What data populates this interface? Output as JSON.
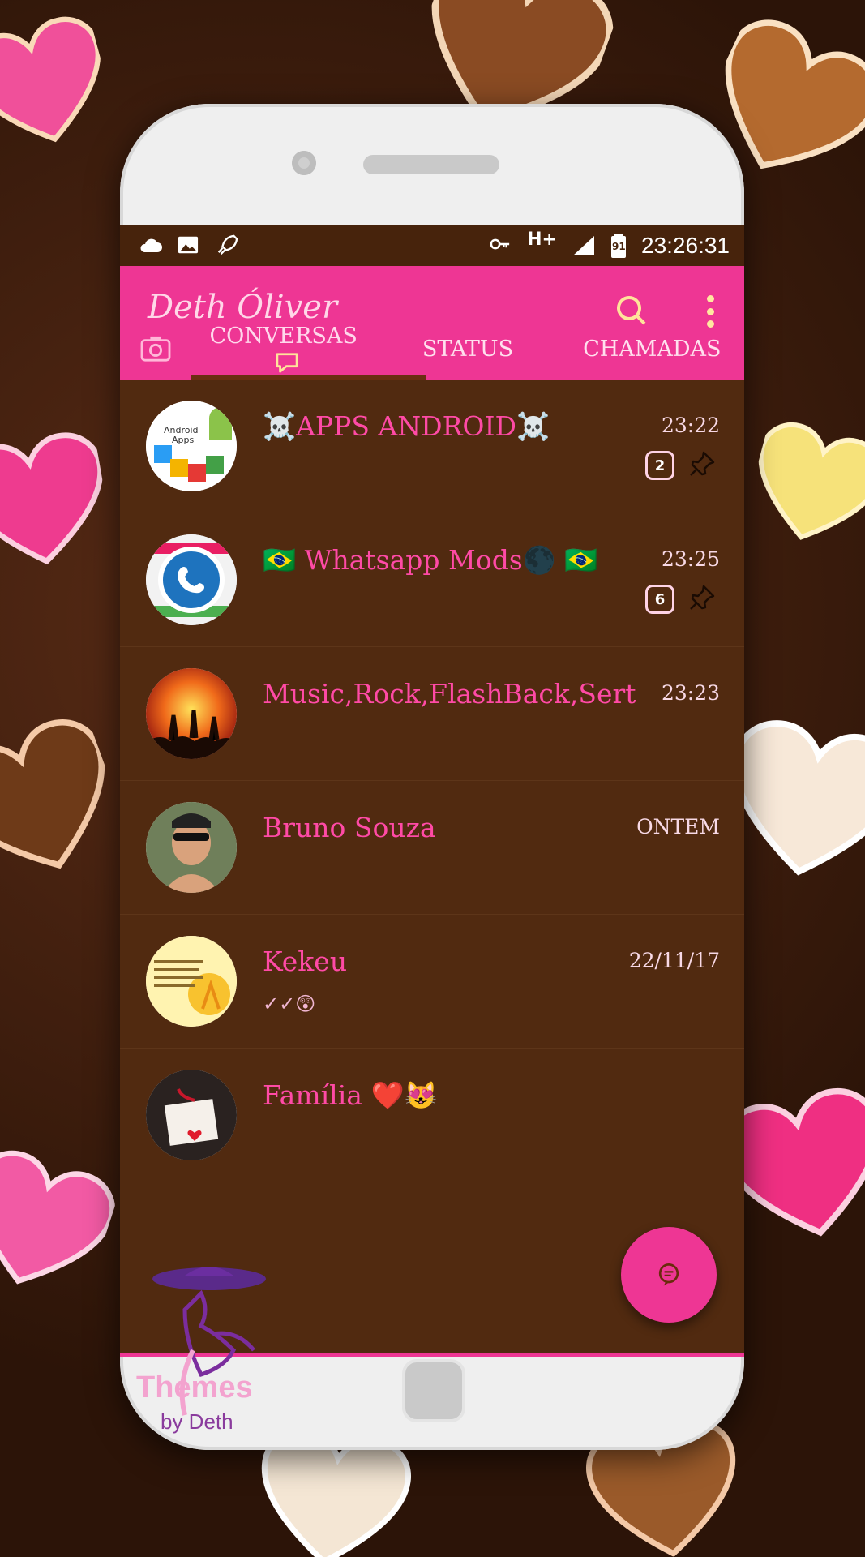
{
  "status_bar": {
    "network": "H+",
    "battery": "91",
    "time": "23:26:31"
  },
  "app": {
    "title": "Deth Óliver"
  },
  "tabs": [
    {
      "label": "CONVERSAS"
    },
    {
      "label": "STATUS"
    },
    {
      "label": "CHAMADAS"
    }
  ],
  "chats": [
    {
      "name": "☠️APPS ANDROID☠️",
      "time": "23:22",
      "subtitle": "",
      "unread": "2",
      "pinned": true
    },
    {
      "name": "🇧🇷 Whatsapp Mods🌑 🇧🇷",
      "time": "23:25",
      "subtitle": "",
      "unread": "6",
      "pinned": true
    },
    {
      "name": "Music,Rock,FlashBack,Sert",
      "time": "23:23",
      "subtitle": "",
      "unread": "",
      "pinned": false
    },
    {
      "name": "Bruno Souza",
      "time": "ONTEM",
      "subtitle": "",
      "unread": "",
      "pinned": false
    },
    {
      "name": "Kekeu",
      "time": "22/11/17",
      "subtitle": "✓✓😲",
      "unread": "",
      "pinned": false
    },
    {
      "name": "Família ❤️😻",
      "time": "",
      "subtitle": "",
      "unread": "",
      "pinned": false
    }
  ],
  "watermark": {
    "line1": "Themes",
    "line2": "by Deth"
  },
  "colors": {
    "accent": "#ee3694",
    "list_bg": "#512a10",
    "name_text": "#ff4aa6"
  }
}
